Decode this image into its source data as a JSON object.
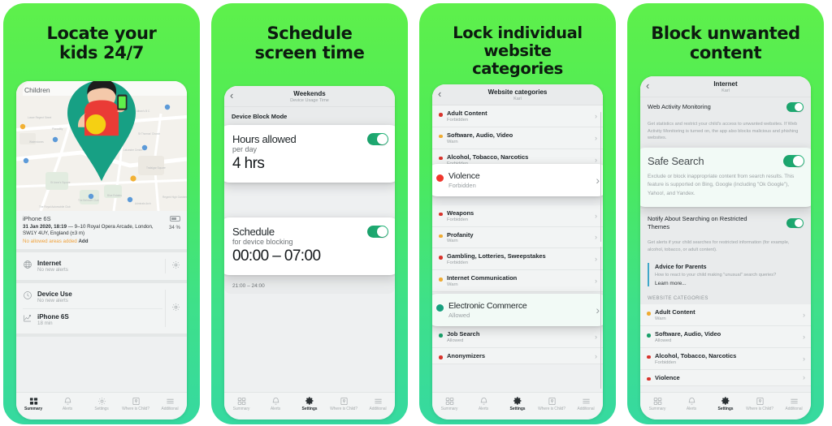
{
  "panels": [
    {
      "title": "Locate your\nkids 24/7",
      "map": {
        "label": "Children"
      },
      "device": {
        "name": "iPhone 6S",
        "timestamp": "31 Jan 2020, 18:19",
        "address": " — 9–10 Royal Opera Arcade, London, SW1Y 4UY, England (±3 m)",
        "alert": "No allowed areas added",
        "add_label": "Add",
        "battery": "34 %"
      },
      "cards": [
        {
          "icon": "globe-icon",
          "title": "Internet",
          "subtitle": "No new alerts"
        },
        {
          "icon": "clock-icon",
          "title": "Device Use",
          "subtitle": "No new alerts"
        },
        {
          "icon": "chart-icon",
          "title": "iPhone 6S",
          "subtitle": "18 min"
        }
      ]
    },
    {
      "title": "Schedule\nscreen time",
      "nav": {
        "title": "Weekends",
        "subtitle": "Device Usage Time",
        "back": "‹"
      },
      "section": "Device Block Mode",
      "card_hours": {
        "title": "Hours allowed",
        "subtitle": "per day",
        "value": "4 hrs",
        "toggle": "on"
      },
      "card_schedule": {
        "title": "Schedule",
        "subtitle": "for device blocking",
        "value": "00:00 – 07:00",
        "toggle": "on"
      },
      "time_row": "21:00  –  24:00"
    },
    {
      "title": "Lock individual\nwebsite\ncategories",
      "nav": {
        "title": "Website categories",
        "subtitle": "Karl",
        "back": "‹"
      },
      "items": [
        {
          "label": "Adult Content",
          "status": "Forbidden",
          "color": "#d8342c"
        },
        {
          "label": "Software, Audio, Video",
          "status": "Warn",
          "color": "#efab32"
        },
        {
          "label": "Alcohol, Tobacco, Narcotics",
          "status": "Forbidden",
          "color": "#d8342c"
        },
        {
          "label": "Weapons",
          "status": "Forbidden",
          "color": "#d8342c"
        },
        {
          "label": "Profanity",
          "status": "Warn",
          "color": "#efab32"
        },
        {
          "label": "Gambling, Lotteries, Sweepstakes",
          "status": "Forbidden",
          "color": "#d8342c"
        },
        {
          "label": "Internet Communication",
          "status": "Warn",
          "color": "#efab32"
        },
        {
          "label": "Job Search",
          "status": "Allowed",
          "color": "#1aa06a"
        },
        {
          "label": "Anonymizers",
          "status": "",
          "color": "#d8342c"
        }
      ],
      "highlight_violence": {
        "label": "Violence",
        "status": "Forbidden",
        "color": "#f0372d"
      },
      "highlight_commerce": {
        "label": "Electronic Commerce",
        "status": "Allowed",
        "color": "#17a07e"
      }
    },
    {
      "title": "Block unwanted\ncontent",
      "nav": {
        "title": "Internet",
        "subtitle": "Karl",
        "back": "‹"
      },
      "web_activity": {
        "label": "Web Activity Monitoring",
        "toggle": "on",
        "description": "Get statistics and restrict your child's access to unwanted websites. If Web Activity Monitoring is turned on, the app also blocks malicious and phishing websites."
      },
      "safe_search": {
        "label": "Safe Search",
        "toggle": "on",
        "description": "Exclude or block inappropriate content from search results. This feature is supported on Bing, Google (including \"Ok Google\"), Yahoo!, and Yandex."
      },
      "notify": {
        "label": "Notify About Searching on Restricted Themes",
        "toggle": "on",
        "description": "Get alerts if your child searches for restricted information (for example, alcohol, tobacco, or adult content)."
      },
      "advice": {
        "title": "Advice for Parents",
        "description": "How to react to your child making \"unusual\" search queries?",
        "link": "Learn more..."
      },
      "section_caps": "WEBSITE CATEGORIES",
      "items": [
        {
          "label": "Adult Content",
          "status": "Warn",
          "color": "#efab32"
        },
        {
          "label": "Software, Audio, Video",
          "status": "Allowed",
          "color": "#1aa06a"
        },
        {
          "label": "Alcohol, Tobacco, Narcotics",
          "status": "Forbidden",
          "color": "#d8342c"
        },
        {
          "label": "Violence",
          "status": "",
          "color": "#d8342c"
        }
      ]
    }
  ],
  "tabbar": {
    "items": [
      {
        "label": "Summary",
        "icon": "grid-icon",
        "active": false
      },
      {
        "label": "Alerts",
        "icon": "bell-icon",
        "active": false
      },
      {
        "label": "Settings",
        "icon": "gear-icon",
        "active": true
      },
      {
        "label": "Where is Child?",
        "icon": "map-pin-icon",
        "active": false
      },
      {
        "label": "Additional",
        "icon": "menu-icon",
        "active": false
      }
    ],
    "panel1_active": "Summary"
  },
  "colors": {
    "bg_top": "#5ef04b",
    "bg_bottom": "#36d9a0",
    "toggle_on": "#1aa06a",
    "forbidden": "#d8342c",
    "warn": "#efab32",
    "allowed": "#1aa06a"
  }
}
